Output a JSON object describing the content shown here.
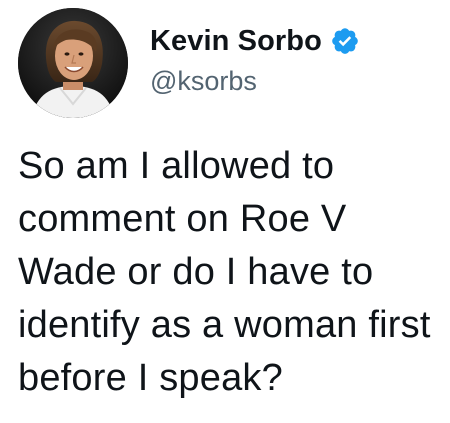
{
  "author": {
    "display_name": "Kevin Sorbo",
    "handle": "@ksorbs",
    "verified": true,
    "avatar_icon": "user-avatar-photo"
  },
  "tweet": {
    "text": "So am I allowed to comment on Roe V Wade or do I have to identify as a woman first before I speak?"
  },
  "colors": {
    "verified_badge": "#1d9bf0",
    "handle_text": "#536471",
    "body_text": "#0f1419"
  }
}
